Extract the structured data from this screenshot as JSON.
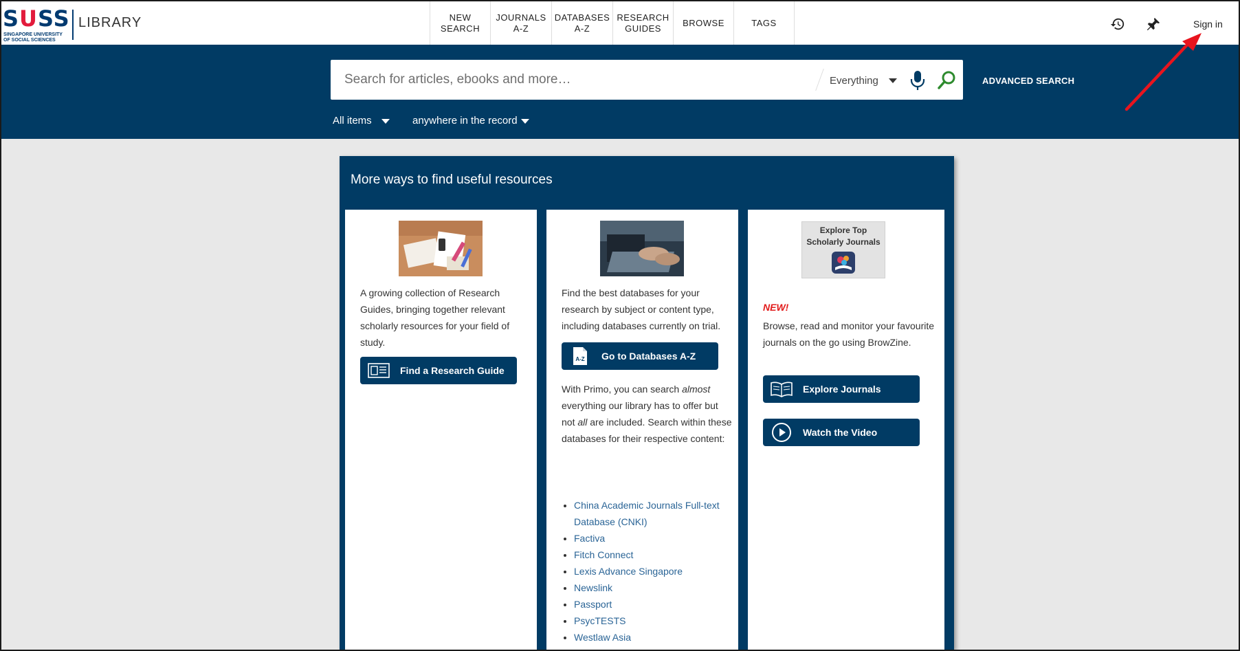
{
  "header": {
    "logo_text": "SUSS",
    "logo_subtitle_line1": "SINGAPORE UNIVERSITY",
    "logo_subtitle_line2": "OF SOCIAL SCIENCES",
    "library_label": "LIBRARY",
    "nav": [
      {
        "label": "NEW\nSEARCH"
      },
      {
        "label": "JOURNALS\nA-Z"
      },
      {
        "label": "DATABASES\nA-Z"
      },
      {
        "label": "RESEARCH\nGUIDES"
      },
      {
        "label": "BROWSE"
      },
      {
        "label": "TAGS"
      }
    ],
    "sign_in": "Sign in"
  },
  "search": {
    "placeholder": "Search for articles, ebooks and more…",
    "scope": "Everything",
    "advanced": "ADVANCED SEARCH",
    "filter_type": "All items",
    "filter_field": "anywhere in the record"
  },
  "panel": {
    "title": "More ways to find useful resources",
    "col1": {
      "text": "A growing collection of Research Guides, bringing together relevant scholarly resources for your field of study.",
      "button": "Find a Research Guide"
    },
    "col2": {
      "text": "Find the best databases for your research by subject or content type, including databases currently on trial.",
      "button": "Go to Databases A-Z",
      "primo_before": "With Primo, you can search ",
      "primo_em1": "almost",
      "primo_mid": " everything our library has to offer but not ",
      "primo_em2": "all",
      "primo_after": " are included. Search within these databases for their respective content:",
      "databases": [
        "China Academic Journals Full-text Database (CNKI)",
        "Factiva",
        "Fitch Connect",
        "Lexis Advance Singapore",
        "Newslink",
        "Passport",
        "PsycTESTS",
        "Westlaw Asia"
      ]
    },
    "col3": {
      "thumb_title": "Explore Top Scholarly Journals",
      "new_label": "NEW!",
      "text": "Browse, read and monitor your favourite journals on the go using BrowZine.",
      "button1": "Explore Journals",
      "button2": "Watch the Video"
    }
  },
  "colors": {
    "brand_navy": "#013b64",
    "accent_red": "#e21b3c",
    "link_blue": "#2a6496",
    "go_green": "#2e8b2e"
  }
}
